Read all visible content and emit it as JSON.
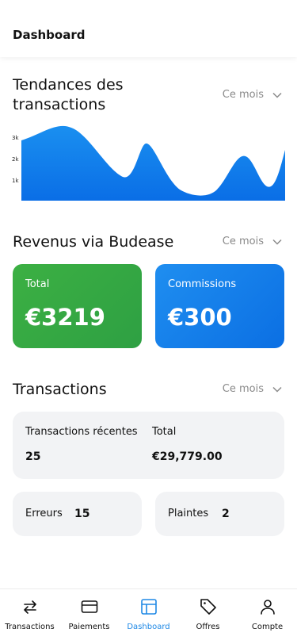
{
  "header": {
    "title": "Dashboard"
  },
  "trends": {
    "title_line1": "Tendances des",
    "title_line2": "transactions",
    "period": "Ce mois",
    "y_ticks": [
      "3k",
      "2k",
      "1k"
    ]
  },
  "revenue": {
    "title": "Revenus via Budease",
    "period": "Ce mois",
    "total_label": "Total",
    "total_value": "€3219",
    "commission_label": "Commissions",
    "commission_value": "€300"
  },
  "transactions": {
    "title": "Transactions",
    "period": "Ce mois",
    "recent_label": "Transactions récentes",
    "total_label": "Total",
    "recent_count": "25",
    "total_amount": "€29,779.00",
    "errors_label": "Erreurs",
    "errors_value": "15",
    "complaints_label": "Plaintes",
    "complaints_value": "2"
  },
  "nav": {
    "items": [
      {
        "label": "Transactions",
        "icon": "arrows-swap-icon"
      },
      {
        "label": "Paiements",
        "icon": "credit-card-icon"
      },
      {
        "label": "Dashboard",
        "icon": "layout-icon"
      },
      {
        "label": "Offres",
        "icon": "tag-icon"
      },
      {
        "label": "Compte",
        "icon": "user-icon"
      }
    ],
    "active": "Dashboard"
  },
  "colors": {
    "accent_blue": "#1e88e5",
    "card_green": "#3cb043",
    "card_blue": "#1a7fe8"
  }
}
